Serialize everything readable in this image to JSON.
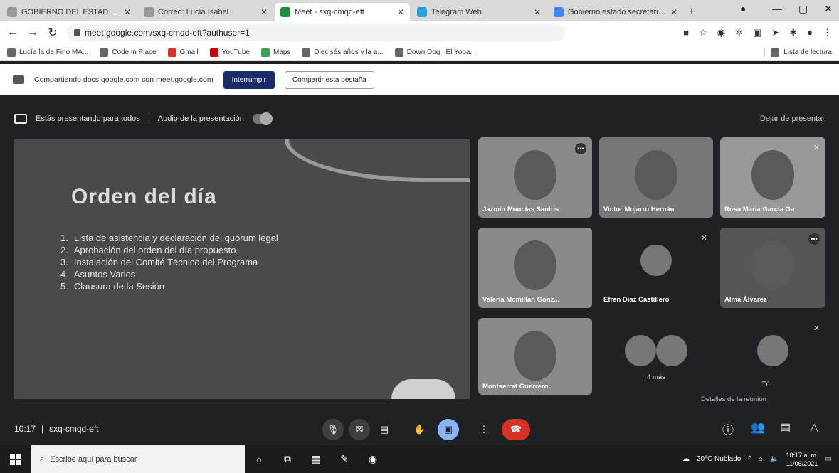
{
  "browser": {
    "tabs": [
      {
        "label": "GOBIERNO DEL ESTADO DE",
        "active": false
      },
      {
        "label": "Correo: Lucía Isabel",
        "active": false
      },
      {
        "label": "Meet - sxq-cmqd-eft",
        "active": true
      },
      {
        "label": "Telegram Web",
        "active": false
      },
      {
        "label": "Gobierno estado secretaria de",
        "active": false
      }
    ],
    "url": "meet.google.com/sxq-cmqd-eft?authuser=1",
    "bookmarks": [
      "Lucía la de Fino MA...",
      "Code in Place",
      "Gmail",
      "YouTube",
      "Maps",
      "Diecisés años y la a...",
      "Down Dog | El Yoga..."
    ],
    "reading_list": "Lista de lectura"
  },
  "sharing_bar": {
    "text": "Compartiendo docs.google.com con meet.google.com",
    "stop_label": "Interrumpir",
    "share_label": "Compartir esta pestaña"
  },
  "meet": {
    "presenting_text": "Estás presentando para todos",
    "audio_label": "Audio de la presentación",
    "stop_presenting": "Dejar de presentar",
    "slide": {
      "title": "Orden del día",
      "items": [
        {
          "num": "1.",
          "text": "Lista de asistencia y declaración del quórum legal"
        },
        {
          "num": "2.",
          "text": "Aprobación del orden del día propuesto"
        },
        {
          "num": "3.",
          "text": "Instalación del Comité Técnico del Programa"
        },
        {
          "num": "4.",
          "text": "Asuntos Varios"
        },
        {
          "num": "5.",
          "text": "Clausura de la Sesión"
        }
      ]
    },
    "participants": {
      "p1": "Jazmín Moncías Santos",
      "p2": "Victor Mojarro Hernán",
      "p3": "Rosa María García Ga",
      "p4": "Valeria Mcmillan Gonz...",
      "p5": "Efren Díaz Castillero",
      "p6": "Alma Álvarez",
      "p7": "Montserrat Guerrero",
      "more": "4 más",
      "you": "Tú"
    },
    "details_label": "Detalles de la reunión",
    "time": "10:17",
    "meeting_code": "sxq-cmqd-eft"
  },
  "taskbar": {
    "search_placeholder": "Escribe aquí para buscar",
    "weather": "20°C Nublado",
    "time": "10:17 a. m.",
    "date": "11/06/2021"
  }
}
